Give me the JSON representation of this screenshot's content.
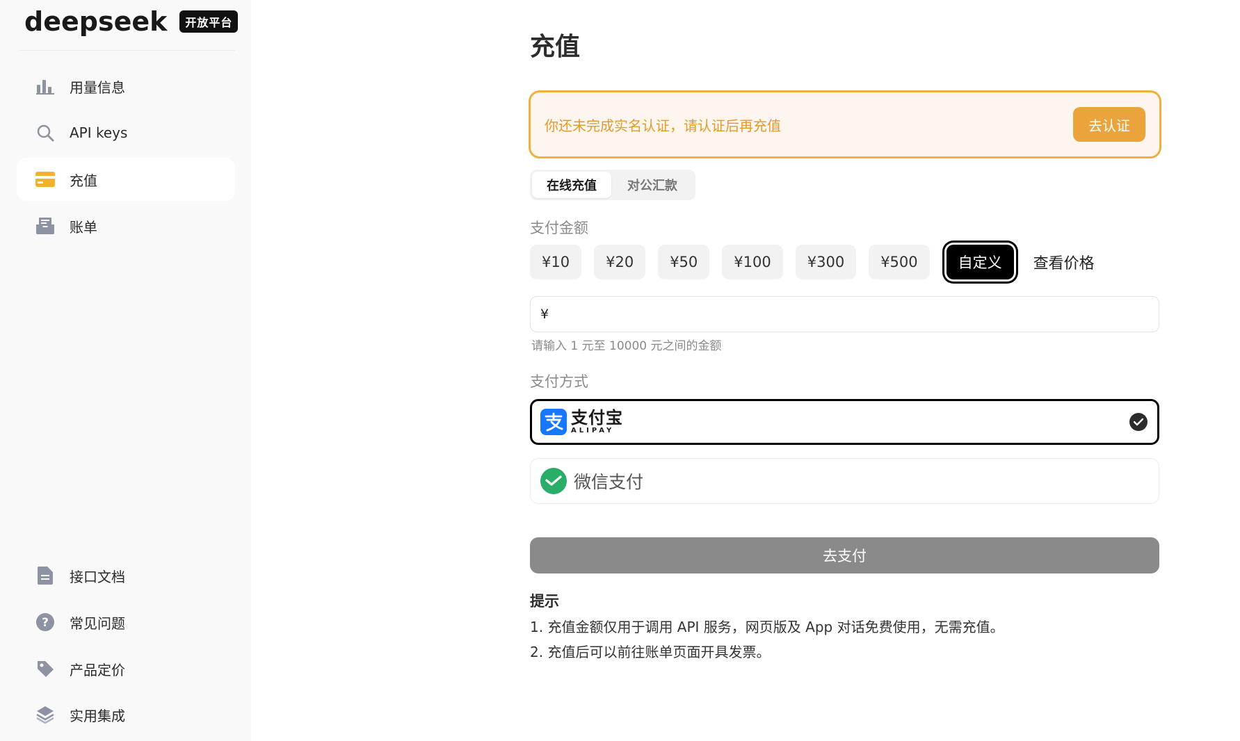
{
  "brand": {
    "logo": "deepseek",
    "badge": "开放平台"
  },
  "sidebar": {
    "top_items": [
      {
        "label": "用量信息",
        "icon": "bar-chart-icon"
      },
      {
        "label": "API keys",
        "icon": "search-icon"
      },
      {
        "label": "充值",
        "icon": "wallet-icon",
        "active": true
      },
      {
        "label": "账单",
        "icon": "inbox-icon"
      }
    ],
    "bottom_items": [
      {
        "label": "接口文档",
        "icon": "document-icon"
      },
      {
        "label": "常见问题",
        "icon": "question-icon"
      },
      {
        "label": "产品定价",
        "icon": "tag-icon"
      },
      {
        "label": "实用集成",
        "icon": "layers-icon"
      }
    ]
  },
  "main": {
    "title": "充值",
    "alert": {
      "text": "你还未完成实名认证，请认证后再充值",
      "button": "去认证"
    },
    "tabs": [
      {
        "label": "在线充值",
        "active": true
      },
      {
        "label": "对公汇款",
        "active": false
      }
    ],
    "amount_section": {
      "label": "支付金额",
      "options": [
        "¥10",
        "¥20",
        "¥50",
        "¥100",
        "¥300",
        "¥500"
      ],
      "custom_label": "自定义",
      "price_link": "查看价格",
      "currency": "¥",
      "input_value": "",
      "hint": "请输入 1 元至 10000 元之间的金额"
    },
    "payment_section": {
      "label": "支付方式",
      "alipay_cn": "支付宝",
      "alipay_en": "ALIPAY",
      "wechat": "微信支付"
    },
    "pay_button": "去支付",
    "tips": {
      "title": "提示",
      "lines": [
        "1. 充值金额仅用于调用 API 服务，网页版及 App 对话免费使用，无需充值。",
        "2. 充值后可以前往账单页面开具发票。"
      ]
    }
  },
  "colors": {
    "accent_orange": "#eba43c",
    "alert_bg": "#fdf6ee",
    "alipay_blue": "#1678ff",
    "wechat_green": "#2aae67",
    "pay_button_gray": "#8a8a8a"
  }
}
